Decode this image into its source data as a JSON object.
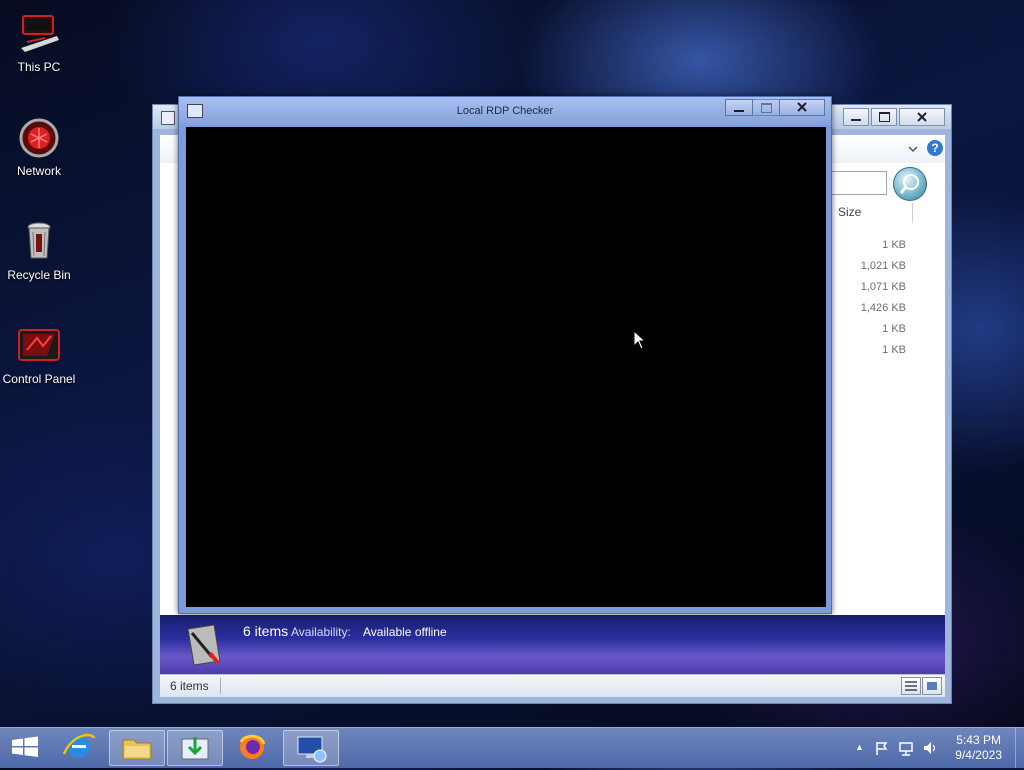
{
  "desktop": {
    "icons": [
      {
        "label": "This PC"
      },
      {
        "label": "Network"
      },
      {
        "label": "Recycle Bin"
      },
      {
        "label": "Control Panel"
      }
    ]
  },
  "explorer": {
    "column_header": "Size",
    "sizes": [
      "1 KB",
      "1,021 KB",
      "1,071 KB",
      "1,426 KB",
      "1 KB",
      "1 KB"
    ],
    "details_pane": {
      "count": "6 items",
      "availability_label": "Availability:",
      "availability_value": "Available offline"
    },
    "status_bar": {
      "items_text": "6 items"
    },
    "help_label": "?"
  },
  "rdp_window": {
    "title": "Local RDP Checker",
    "minimize": "_",
    "close": "X"
  },
  "taskbar": {
    "apps": [
      {
        "icon": "start-icon"
      },
      {
        "icon": "internet-explorer-icon"
      },
      {
        "icon": "file-explorer-icon"
      },
      {
        "icon": "download-manager-icon"
      },
      {
        "icon": "firefox-icon"
      },
      {
        "icon": "remote-desktop-icon"
      }
    ],
    "tray_arrow": "▲",
    "clock": {
      "time": "5:43 PM",
      "date": "9/4/2023"
    }
  }
}
